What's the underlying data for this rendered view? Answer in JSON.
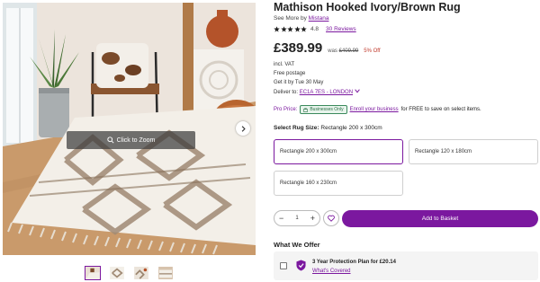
{
  "gallery": {
    "zoom_label": "Click to Zoom",
    "thumbnail_count": 4,
    "active_thumbnail": 1
  },
  "product": {
    "title": "Mathison Hooked Ivory/Brown Rug",
    "see_more_prefix": "See More by",
    "brand": "Mistana",
    "rating": "4.8",
    "rating_stars": 5,
    "reviews": "30 Reviews",
    "price": "£389.99",
    "was_label": "was",
    "was_price": "£409.99",
    "discount": "5% Off",
    "vat": "incl. VAT",
    "postage": "Free postage",
    "delivery_date": "Get it by Tue 30 May",
    "deliver_to_label": "Deliver to:",
    "deliver_to_location": "EC1A 7ES - LONDON"
  },
  "pro_price": {
    "label": "Pro Price:",
    "badge": "Businesses Only",
    "enroll_link": "Enroll your business",
    "rest": "for FREE to save on select items."
  },
  "size_selector": {
    "label_prefix": "Select Rug Size:",
    "selected_value": "Rectangle 200 x 300cm",
    "options": [
      {
        "label": "Rectangle 200 x 300cm",
        "selected": true
      },
      {
        "label": "Rectangle 120 x 180cm",
        "selected": false
      },
      {
        "label": "Rectangle 160 x 230cm",
        "selected": false
      }
    ]
  },
  "cart": {
    "minus": "−",
    "quantity": "1",
    "plus": "+",
    "add_to_basket": "Add to Basket"
  },
  "offer": {
    "heading": "What We Offer",
    "plan": "3 Year Protection Plan for £20.14",
    "covered_link": "What's Covered"
  },
  "colors": {
    "accent": "#7b189f",
    "discount": "#c0392b",
    "badge_green": "#2a6f47"
  }
}
